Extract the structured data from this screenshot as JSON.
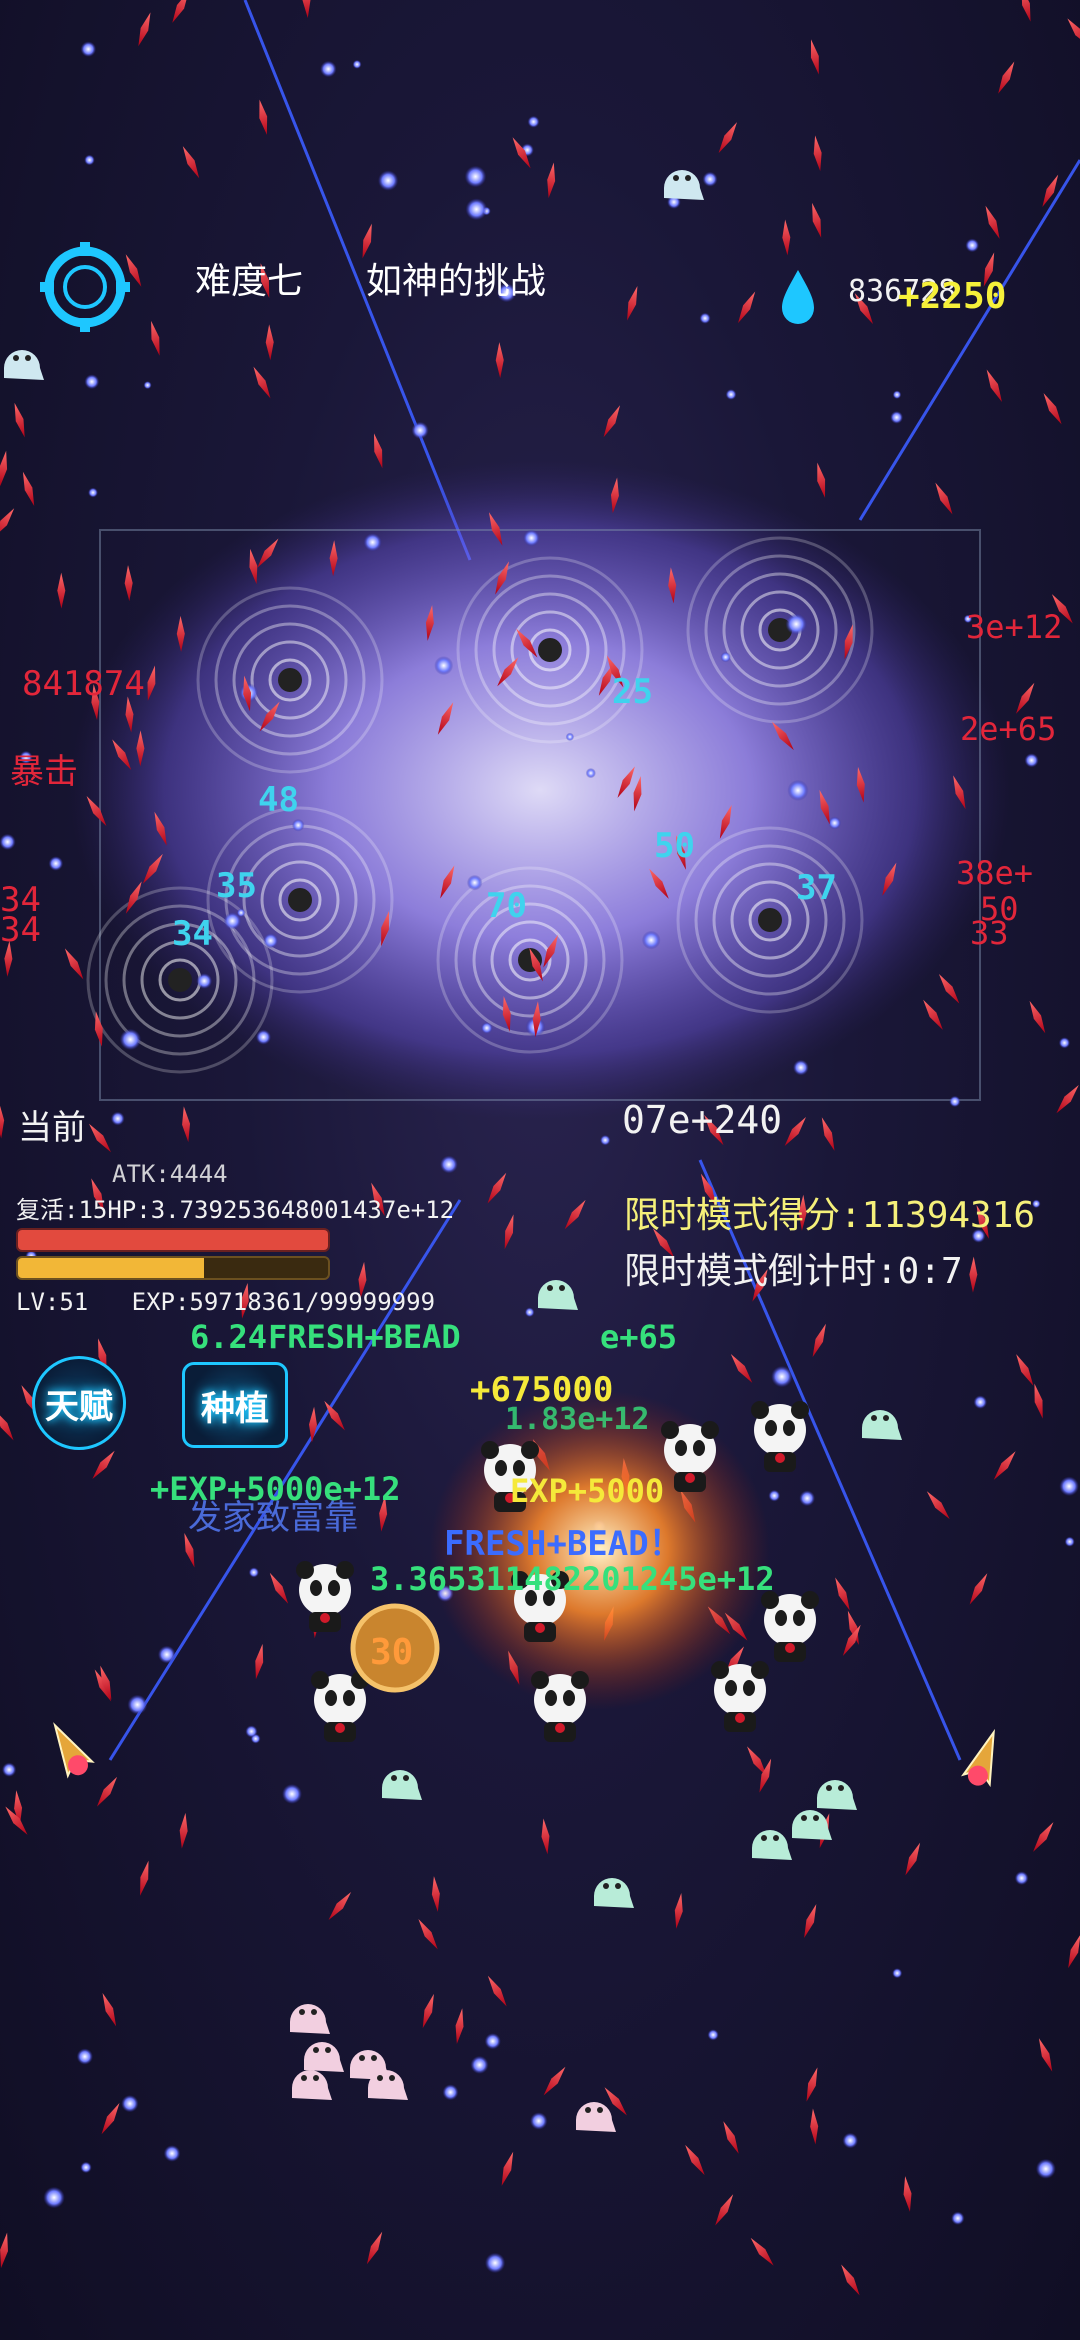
{
  "header": {
    "difficulty": "难度七",
    "difficulty_desc": "如神的挑战",
    "currency_value": "836728",
    "currency_gain": "+2250"
  },
  "stats": {
    "label_current": "当前",
    "atk": "ATK:4444",
    "revive_hp": "复活:15HP:3.739253648001437e+12",
    "hp_fill_fraction": 1.0,
    "exp_fill_fraction": 0.6,
    "level_exp": "LV:51   EXP:59718361/99999999",
    "partial_value": "07e+240"
  },
  "timed_mode": {
    "score": "限时模式得分:11394316",
    "countdown": "限时模式倒计时:0:7"
  },
  "buttons": {
    "talent": "天赋",
    "plant": "种植"
  },
  "floating_text": {
    "cyan_damage": [
      "25",
      "48",
      "50",
      "70",
      "35",
      "34",
      "37"
    ],
    "red_left": [
      "841874",
      "暴击",
      "34",
      "34"
    ],
    "red_right": [
      "3e+12",
      "2e+65",
      "38e+",
      "50",
      "33"
    ],
    "green": [
      "6.24",
      "FRESH+BEAD",
      "+12",
      "e+65",
      "5000",
      "1.83e+12",
      "+EXP+5000e+12",
      "3.365311482201245e+12"
    ],
    "yellow": [
      "+675000",
      "EXP+5000"
    ],
    "fresh_banner": "FRESH+BEAD！",
    "rich_text": "发家致富靠"
  },
  "icons": {
    "settings": "settings-ring-icon",
    "currency": "water-drop-icon"
  },
  "colors": {
    "hp_bar": "#e24a3e",
    "exp_bar": "#f2b737",
    "accent_cyan": "#1ec7ff"
  }
}
